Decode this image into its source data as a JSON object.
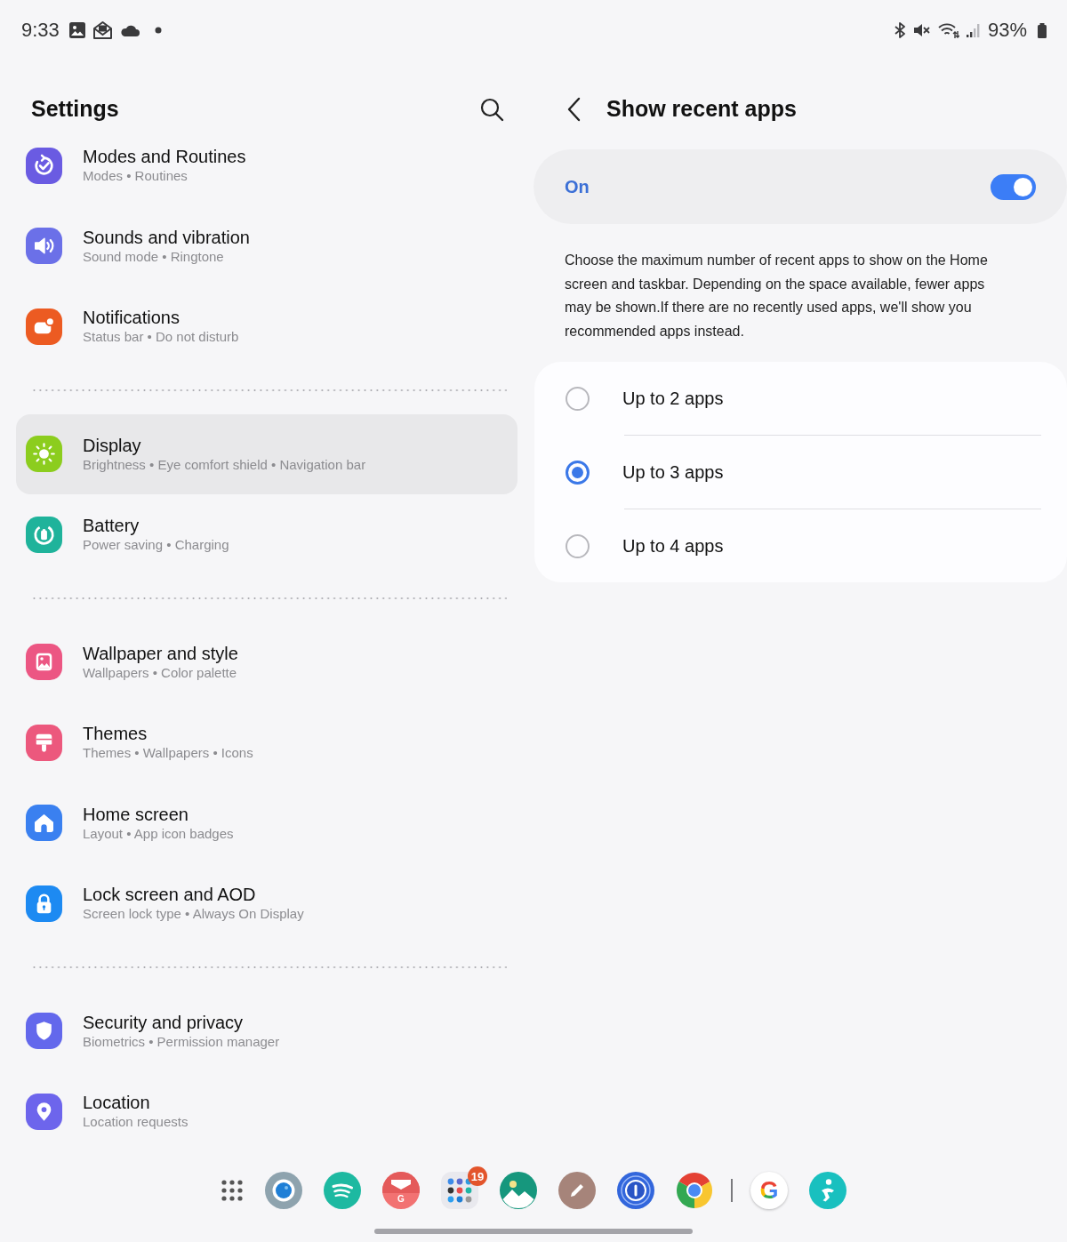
{
  "status_bar": {
    "time": "9:33",
    "battery": "93%"
  },
  "settings": {
    "title": "Settings",
    "groups": [
      {
        "items": [
          {
            "kind": "routine",
            "title": "Modes and Routines",
            "subtitle": "Modes • Routines",
            "selected": false
          },
          {
            "kind": "sound",
            "title": "Sounds and vibration",
            "subtitle": "Sound mode • Ringtone",
            "selected": false
          },
          {
            "kind": "notifications",
            "title": "Notifications",
            "subtitle": "Status bar • Do not disturb",
            "selected": false
          }
        ]
      },
      {
        "items": [
          {
            "kind": "display",
            "title": "Display",
            "subtitle": "Brightness • Eye comfort shield • Navigation bar",
            "selected": true
          },
          {
            "kind": "battery",
            "title": "Battery",
            "subtitle": "Power saving • Charging",
            "selected": false
          }
        ]
      },
      {
        "items": [
          {
            "kind": "wallpaper",
            "title": "Wallpaper and style",
            "subtitle": "Wallpapers • Color palette",
            "selected": false
          },
          {
            "kind": "themes",
            "title": "Themes",
            "subtitle": "Themes • Wallpapers • Icons",
            "selected": false
          },
          {
            "kind": "home",
            "title": "Home screen",
            "subtitle": "Layout • App icon badges",
            "selected": false
          },
          {
            "kind": "lock",
            "title": "Lock screen and AOD",
            "subtitle": "Screen lock type • Always On Display",
            "selected": false
          }
        ]
      },
      {
        "items": [
          {
            "kind": "security",
            "title": "Security and privacy",
            "subtitle": "Biometrics • Permission manager",
            "selected": false
          },
          {
            "kind": "location",
            "title": "Location",
            "subtitle": "Location requests",
            "selected": false
          }
        ]
      }
    ]
  },
  "detail": {
    "title": "Show recent apps",
    "master_switch": {
      "label": "On",
      "on": true
    },
    "description": "Choose the maximum number of recent apps to show on the Home screen and taskbar. Depending on the space available, fewer apps may be shown.If there are no recently used apps, we'll show you recommended apps instead.",
    "options": [
      {
        "label": "Up to 2 apps",
        "selected": false
      },
      {
        "label": "Up to 3 apps",
        "selected": true
      },
      {
        "label": "Up to 4 apps",
        "selected": false
      }
    ]
  },
  "taskbar": {
    "pinned": [
      {
        "kind": "drawer"
      },
      {
        "kind": "lens"
      },
      {
        "kind": "waves"
      },
      {
        "kind": "mail",
        "letter": "G"
      },
      {
        "kind": "folder",
        "badge": "19"
      },
      {
        "kind": "gallery"
      },
      {
        "kind": "pencil"
      },
      {
        "kind": "keyhole"
      },
      {
        "kind": "browser"
      }
    ],
    "recent": [
      {
        "kind": "letter",
        "letter": "G"
      },
      {
        "kind": "figure"
      }
    ]
  }
}
